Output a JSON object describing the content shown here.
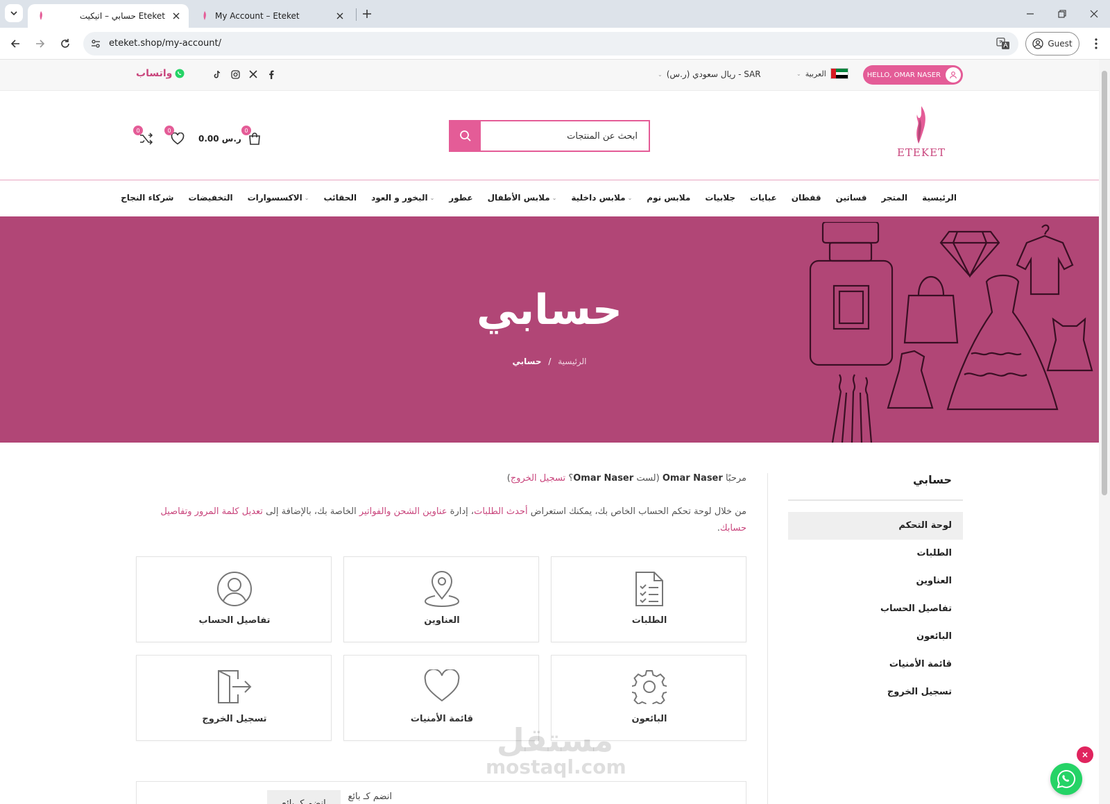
{
  "browser": {
    "tabs": [
      {
        "label": "حسابي – اتيكيت Eteket",
        "active": true
      },
      {
        "label": "My Account – Eteket",
        "active": false
      }
    ],
    "url": "eteket.shop/my-account/",
    "profile": "Guest"
  },
  "topbar": {
    "whatsapp_label": "واتساب",
    "currency": "ريال سعودي (ر.س) - SAR",
    "language": "العربية",
    "hello": "HELLO, OMAR NASER"
  },
  "header": {
    "logo_text": "ETEKET",
    "search_placeholder": "ابحث عن المنتجات",
    "cart_total": "0.00 ر.س",
    "cart_count": "0",
    "wishlist_count": "0",
    "compare_count": "0"
  },
  "nav": {
    "items": [
      {
        "label": "الرئيسية",
        "dropdown": false
      },
      {
        "label": "المتجر",
        "dropdown": false
      },
      {
        "label": "فساتين",
        "dropdown": false
      },
      {
        "label": "قفطان",
        "dropdown": false
      },
      {
        "label": "عبايات",
        "dropdown": false
      },
      {
        "label": "جلابيات",
        "dropdown": false
      },
      {
        "label": "ملابس نوم",
        "dropdown": false
      },
      {
        "label": "ملابس داخلية",
        "dropdown": true
      },
      {
        "label": "ملابس الأطفال",
        "dropdown": true
      },
      {
        "label": "عطور",
        "dropdown": false
      },
      {
        "label": "البخور و العود",
        "dropdown": true
      },
      {
        "label": "الحقائب",
        "dropdown": false
      },
      {
        "label": "الاكسسوارات",
        "dropdown": true
      },
      {
        "label": "التخفيضات",
        "dropdown": false
      },
      {
        "label": "شركاء النجاح",
        "dropdown": false
      }
    ]
  },
  "hero": {
    "title": "حسابي",
    "breadcrumb_home": "الرئيسية",
    "breadcrumb_sep": "/",
    "breadcrumb_current": "حسابي"
  },
  "sidebar": {
    "title": "حسابي",
    "items": [
      {
        "label": "لوحة التحكم",
        "active": true
      },
      {
        "label": "الطلبات"
      },
      {
        "label": "العناوين"
      },
      {
        "label": "تفاصيل الحساب"
      },
      {
        "label": "البائعون"
      },
      {
        "label": "قائمة الأمنيات"
      },
      {
        "label": "تسجيل الخروج"
      }
    ]
  },
  "dashboard": {
    "greeting_prefix": "مرحبًا",
    "user_name": "Omar Naser",
    "not_you_prefix": "(لست",
    "not_you_suffix": "؟",
    "logout_link": "تسجيل الخروج",
    "close_paren": ")",
    "intro_1": "من خلال لوحة تحكم الحساب الخاص بك، يمكنك استعراض",
    "intro_link_orders": "أحدث الطلبات",
    "intro_2": "، إدارة",
    "intro_link_addresses": "عناوين الشحن والفواتير",
    "intro_3": "الخاصة بك، بالإضافة إلى",
    "intro_link_account": "تعديل كلمة المرور وتفاصيل حسابك",
    "intro_4": ".",
    "tiles": [
      {
        "label": "الطلبات",
        "icon": "orders-icon"
      },
      {
        "label": "العناوين",
        "icon": "location-pin-icon"
      },
      {
        "label": "تفاصيل الحساب",
        "icon": "user-icon"
      },
      {
        "label": "البائعون",
        "icon": "gear-icon"
      },
      {
        "label": "قائمة الأمنيات",
        "icon": "heart-icon"
      },
      {
        "label": "تسجيل الخروج",
        "icon": "logout-icon"
      }
    ],
    "vendor_label": "انضم كـ بائع",
    "vendor_button": "انضم كـ بائع"
  },
  "watermark": {
    "line1": "مستقل",
    "line2": "mostaql.com"
  },
  "colors": {
    "accent": "#e45c97",
    "hero_bg": "#b14676",
    "link": "#c9467d",
    "whatsapp": "#25d366"
  }
}
